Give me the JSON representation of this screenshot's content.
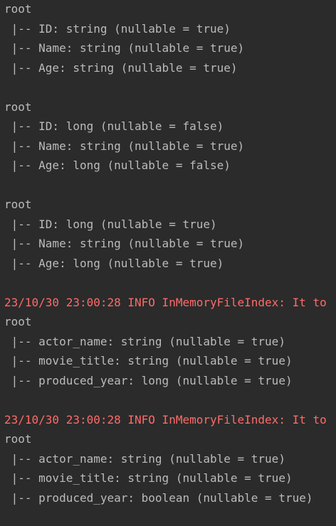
{
  "console": {
    "lines": [
      {
        "text": "root",
        "kind": "out"
      },
      {
        "text": " |-- ID: string (nullable = true)",
        "kind": "out"
      },
      {
        "text": " |-- Name: string (nullable = true)",
        "kind": "out"
      },
      {
        "text": " |-- Age: string (nullable = true)",
        "kind": "out"
      },
      {
        "text": "",
        "kind": "out"
      },
      {
        "text": "root",
        "kind": "out"
      },
      {
        "text": " |-- ID: long (nullable = false)",
        "kind": "out"
      },
      {
        "text": " |-- Name: string (nullable = true)",
        "kind": "out"
      },
      {
        "text": " |-- Age: long (nullable = false)",
        "kind": "out"
      },
      {
        "text": "",
        "kind": "out"
      },
      {
        "text": "root",
        "kind": "out"
      },
      {
        "text": " |-- ID: long (nullable = true)",
        "kind": "out"
      },
      {
        "text": " |-- Name: string (nullable = true)",
        "kind": "out"
      },
      {
        "text": " |-- Age: long (nullable = true)",
        "kind": "out"
      },
      {
        "text": "",
        "kind": "out"
      },
      {
        "text": "23/10/30 23:00:28 INFO InMemoryFileIndex: It to",
        "kind": "log"
      },
      {
        "text": "root",
        "kind": "out"
      },
      {
        "text": " |-- actor_name: string (nullable = true)",
        "kind": "out"
      },
      {
        "text": " |-- movie_title: string (nullable = true)",
        "kind": "out"
      },
      {
        "text": " |-- produced_year: long (nullable = true)",
        "kind": "out"
      },
      {
        "text": "",
        "kind": "out"
      },
      {
        "text": "23/10/30 23:00:28 INFO InMemoryFileIndex: It to",
        "kind": "log"
      },
      {
        "text": "root",
        "kind": "out"
      },
      {
        "text": " |-- actor_name: string (nullable = true)",
        "kind": "out"
      },
      {
        "text": " |-- movie_title: string (nullable = true)",
        "kind": "out"
      },
      {
        "text": " |-- produced_year: boolean (nullable = true)",
        "kind": "out"
      }
    ],
    "colors": {
      "background": "#2b2b2b",
      "stdout_text": "#bbbbbb",
      "log_text": "#ff6b68"
    }
  }
}
